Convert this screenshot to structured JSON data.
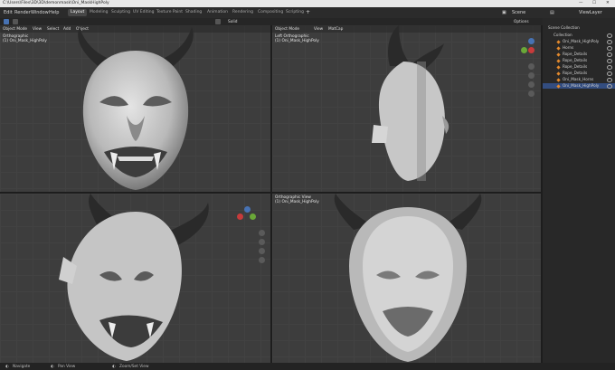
{
  "window": {
    "title_path": "C:\\Users\\Files\\3D\\3D\\demonmask\\Oni_MaskHighPoly"
  },
  "menu": {
    "items": [
      "Edit",
      "Render",
      "Window",
      "Help"
    ]
  },
  "workspaces": {
    "tabs": [
      "Layout",
      "Modeling",
      "Sculpting",
      "UV Editing",
      "Texture Paint",
      "Shading",
      "Animation",
      "Rendering",
      "Compositing",
      "Scripting"
    ],
    "active": "Layout"
  },
  "scene": {
    "name": "Scene",
    "view_layer": "ViewLayer"
  },
  "toolbar": {
    "shading_mode": "Solid",
    "options_label": "Options"
  },
  "viewports": {
    "top_left": {
      "view_name": "Orthographic",
      "object_name": "(1) Oni_Mask_HighPoly",
      "mode": "Object Mode",
      "menu": [
        "View",
        "Select",
        "Add",
        "Object"
      ]
    },
    "top_right": {
      "view_name": "Left Orthographic",
      "object_name": "(1) Oni_Mask_HighPoly",
      "mode": "Object Mode",
      "menu": [
        "View",
        "MatCap"
      ]
    },
    "bottom_left": {
      "view_name": "",
      "object_name": ""
    },
    "bottom_right": {
      "view_name": "Orthographic View",
      "object_name": "(1) Oni_Mask_HighPoly"
    }
  },
  "outliner": {
    "title": "Scene Collection",
    "collection": "Collection",
    "items": [
      "Oni_Mask_HighPoly",
      "Horns",
      "Rope_Details",
      "Rope_Details",
      "Rope_Details",
      "Rope_Details",
      "Oni_Mask_Horns",
      "Oni_Mask_HighPoly"
    ]
  },
  "statusbar": {
    "items": [
      "Navigate",
      "Pan View",
      "Zoom/Set View"
    ]
  },
  "colors": {
    "accent": "#4772b3",
    "object_orange": "#e48a2d",
    "viewport_bg": "#3d3d3d"
  }
}
